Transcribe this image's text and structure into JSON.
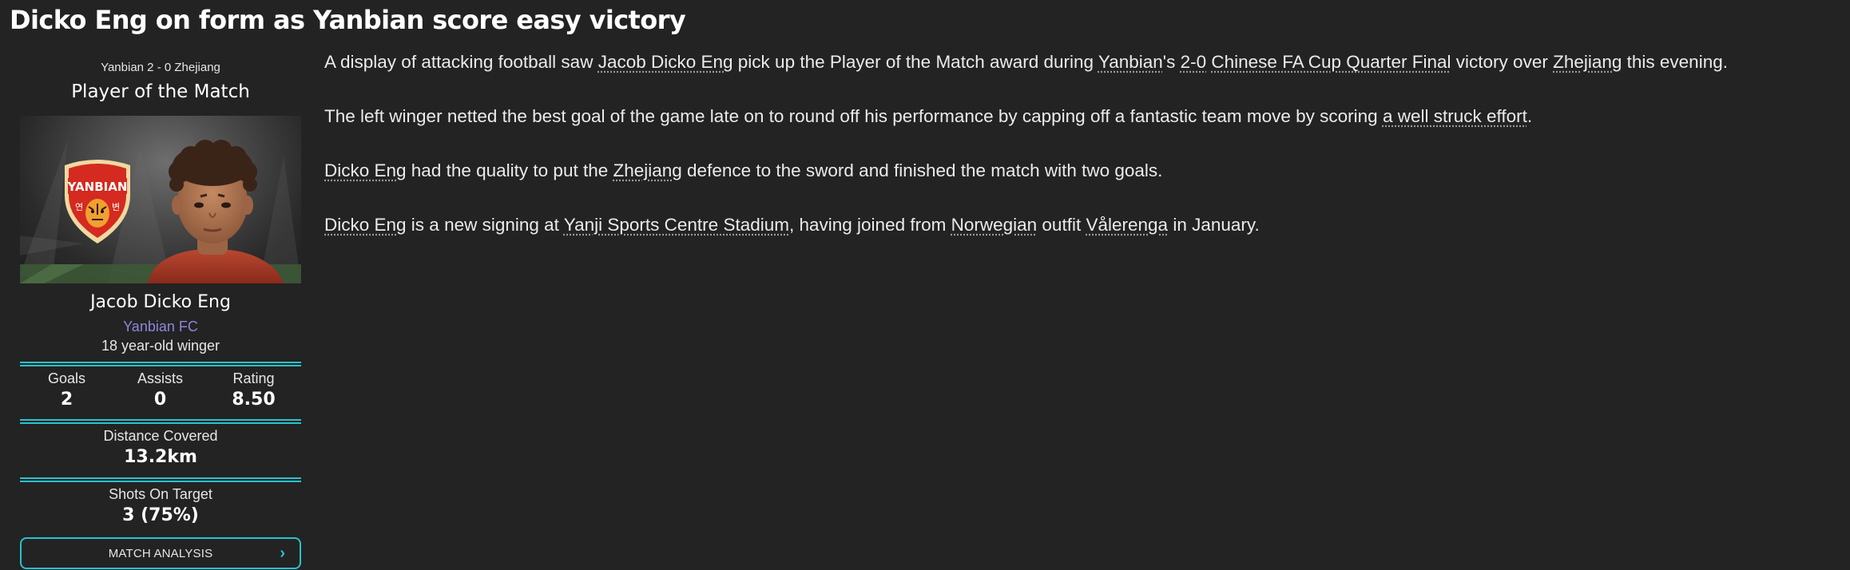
{
  "headline": "Dicko Eng on form as Yanbian score easy victory",
  "card": {
    "match_score": "Yanbian 2 - 0 Zhejiang",
    "title": "Player of the Match",
    "badge_text": "YANBIAN",
    "badge_hangul_left": "연",
    "badge_hangul_right": "변",
    "player_name": "Jacob Dicko Eng",
    "club": "Yanbian FC",
    "description": "18 year-old winger",
    "stats": [
      {
        "label": "Goals",
        "value": "2"
      },
      {
        "label": "Assists",
        "value": "0"
      },
      {
        "label": "Rating",
        "value": "8.50"
      }
    ],
    "distance": {
      "label": "Distance Covered",
      "value": "13.2km"
    },
    "shots": {
      "label": "Shots On Target",
      "value": "3 (75%)"
    },
    "button_label": "MATCH ANALYSIS",
    "button_icon": "chevron-right-icon"
  },
  "article": {
    "p1": {
      "t1": "A display of attacking football saw ",
      "player": "Jacob Dicko Eng",
      "t2": " pick up the Player of the Match award during ",
      "team": "Yanbian",
      "t3": "'s ",
      "result": "2-0",
      "t4": " ",
      "competition": "Chinese FA Cup Quarter Final",
      "t5": " victory over ",
      "opponent": "Zhejiang",
      "t6": " this evening."
    },
    "p2": {
      "t1": "The left winger netted the best goal of the game late on to round off his performance by capping off a fantastic team move by scoring ",
      "goal": "a well struck effort",
      "t2": "."
    },
    "p3": {
      "player": "Dicko Eng",
      "t1": " had the quality to put the ",
      "opponent": "Zhejiang",
      "t2": " defence to the sword and finished the match with two goals."
    },
    "p4": {
      "player": "Dicko Eng",
      "t1": " is a new signing at ",
      "stadium": "Yanji Sports Centre Stadium",
      "t2": ", having joined from ",
      "nation": "Norwegian",
      "t3": " outfit ",
      "club": "Vålerenga",
      "t4": " in January."
    }
  },
  "colors": {
    "background": "#232323",
    "accent": "#26c3cf",
    "club_link": "#8d86db",
    "badge_red": "#d42a1f"
  }
}
